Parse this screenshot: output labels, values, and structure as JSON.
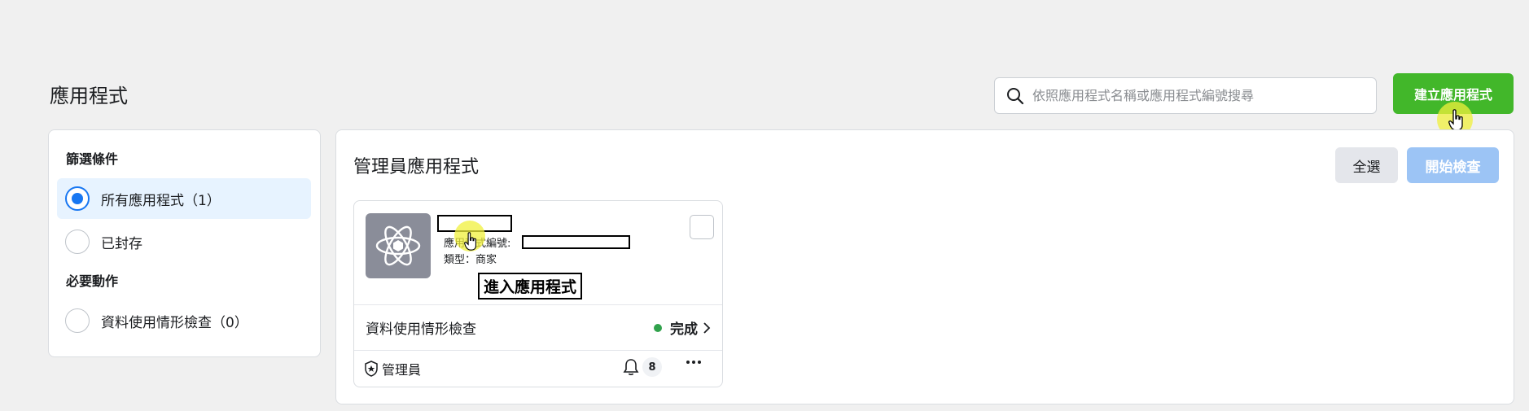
{
  "header": {
    "title": "應用程式",
    "search_placeholder": "依照應用程式名稱或應用程式編號搜尋",
    "create_button": "建立應用程式"
  },
  "filters": {
    "heading": "篩選條件",
    "options": [
      {
        "label": "所有應用程式（1）",
        "selected": true
      },
      {
        "label": "已封存",
        "selected": false
      }
    ],
    "required_heading": "必要動作",
    "required_options": [
      {
        "label": "資料使用情形檢查（0）",
        "selected": false
      }
    ]
  },
  "main": {
    "section_title": "管理員應用程式",
    "select_all": "全選",
    "start_review": "開始檢查"
  },
  "app_card": {
    "app_id_label": "應用程式編號:",
    "type_label": "類型：商家",
    "enter_app": "進入應用程式",
    "review_label": "資料使用情形檢查",
    "review_status": "完成",
    "role": "管理員",
    "notification_count": "8",
    "icon": "react-atom-icon"
  },
  "colors": {
    "accent_green": "#42b72a",
    "accent_blue": "#1877f2",
    "disabled_blue": "#9cc4f5",
    "status_green": "#31a24c"
  }
}
